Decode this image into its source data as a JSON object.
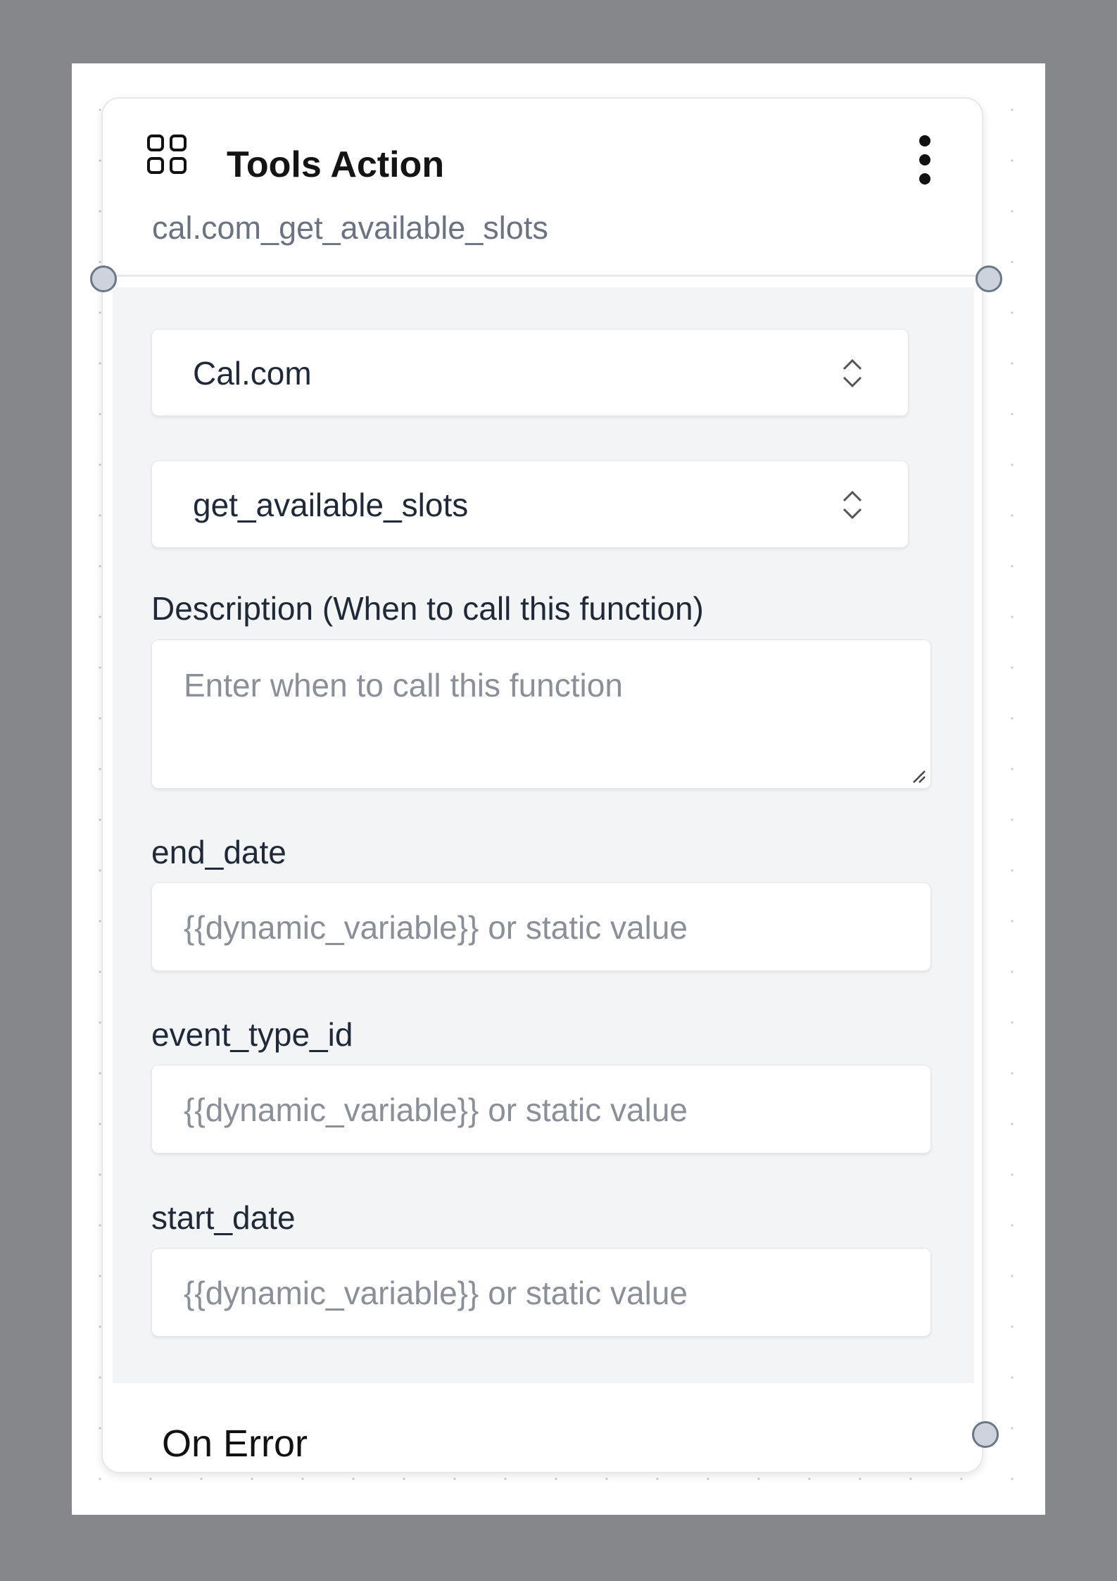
{
  "node": {
    "icon": "tools-grid-icon",
    "title": "Tools Action",
    "subtitle": "cal.com_get_available_slots",
    "menu_icon": "more-vertical-icon"
  },
  "tool_select": {
    "value": "Cal.com",
    "icon": "chevron-up-down-icon"
  },
  "function_select": {
    "value": "get_available_slots",
    "icon": "chevron-up-down-icon"
  },
  "description": {
    "label": "Description (When to call this function)",
    "placeholder": "Enter when to call this function"
  },
  "params": [
    {
      "label": "end_date",
      "placeholder": "{{dynamic_variable}} or static value"
    },
    {
      "label": "event_type_id",
      "placeholder": "{{dynamic_variable}} or static value"
    },
    {
      "label": "start_date",
      "placeholder": "{{dynamic_variable}} or static value"
    }
  ],
  "footer": {
    "on_error": "On Error"
  },
  "colors": {
    "backdrop": "#86878a",
    "canvas": "#ffffff",
    "node_body": "#f3f4f6",
    "handle_fill": "#cdd3dc",
    "handle_stroke": "#6b7686",
    "subtitle": "#6b7280",
    "placeholder": "#8a8f98"
  }
}
